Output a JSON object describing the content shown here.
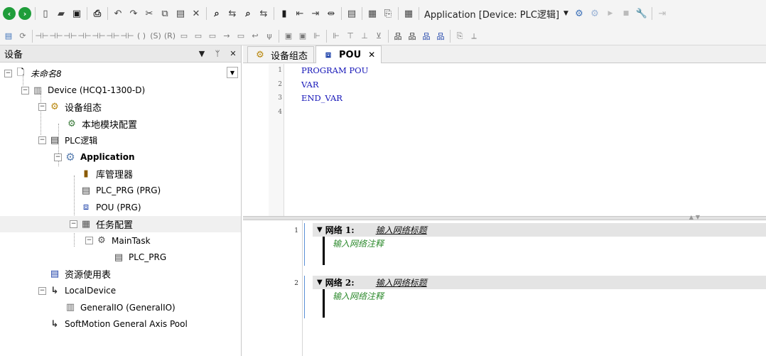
{
  "toolbar": {
    "application_selector": "Application [Device: PLC逻辑]"
  },
  "panel": {
    "title": "设备",
    "pin_icon": "ᛘ",
    "dropdown_icon": "▼",
    "close_icon": "✕"
  },
  "tree": [
    {
      "id": "root",
      "label": "未命名8",
      "icon": "project-icon",
      "glyph": "🗋"
    },
    {
      "id": "device",
      "label": "Device (HCQ1-1300-D)",
      "icon": "device-icon",
      "glyph": "▥"
    },
    {
      "id": "device-config",
      "label": "设备组态",
      "icon": "config-icon",
      "glyph": "⚙"
    },
    {
      "id": "local-module",
      "label": "本地模块配置",
      "icon": "module-icon",
      "glyph": "⚙"
    },
    {
      "id": "plc-logic",
      "label": "PLC逻辑",
      "icon": "plc-icon",
      "glyph": "▤"
    },
    {
      "id": "application",
      "label": "Application",
      "icon": "application-gear-icon",
      "glyph": "⚙"
    },
    {
      "id": "library-manager",
      "label": "库管理器",
      "icon": "library-icon",
      "glyph": "▮"
    },
    {
      "id": "plc-prg",
      "label": "PLC_PRG (PRG)",
      "icon": "pou-document-icon",
      "glyph": "▤"
    },
    {
      "id": "pou",
      "label": "POU (PRG)",
      "icon": "pou-ld-icon",
      "glyph": "⧈"
    },
    {
      "id": "task-config",
      "label": "任务配置",
      "icon": "task-config-icon",
      "glyph": "▦"
    },
    {
      "id": "maintask",
      "label": "MainTask",
      "icon": "task-icon",
      "glyph": "⚙"
    },
    {
      "id": "task-plc-prg",
      "label": "PLC_PRG",
      "icon": "program-call-icon",
      "glyph": "▤"
    },
    {
      "id": "resource-usage",
      "label": "资源使用表",
      "icon": "table-icon",
      "glyph": "▤"
    },
    {
      "id": "local-device",
      "label": "LocalDevice",
      "icon": "axis-icon",
      "glyph": "↳"
    },
    {
      "id": "general-io",
      "label": "GeneralIO (GeneralIO)",
      "icon": "io-icon",
      "glyph": "▥"
    },
    {
      "id": "softmotion",
      "label": "SoftMotion General Axis Pool",
      "icon": "axis-pool-icon",
      "glyph": "↳"
    }
  ],
  "tabs": [
    {
      "label": "设备组态",
      "icon": "config-icon",
      "glyph": "⚙"
    },
    {
      "label": "POU",
      "icon": "pou-ld-icon",
      "glyph": "⧈",
      "close": "✕"
    }
  ],
  "declaration": {
    "line_numbers": [
      "1",
      "2",
      "3",
      "4"
    ],
    "lines": [
      "PROGRAM POU",
      "VAR",
      "END_VAR"
    ]
  },
  "networks": [
    {
      "num": "1",
      "label": "网络 1:",
      "title": "输入网络标题",
      "comment": "输入网络注释"
    },
    {
      "num": "2",
      "label": "网络 2:",
      "title": "输入网络标题",
      "comment": "输入网络注释"
    }
  ],
  "colors": {
    "keyword": "#1515b8",
    "comment": "#2e8b2e",
    "nav_green": "#1f9d3a",
    "rail_blue": "#5a8fd6"
  }
}
